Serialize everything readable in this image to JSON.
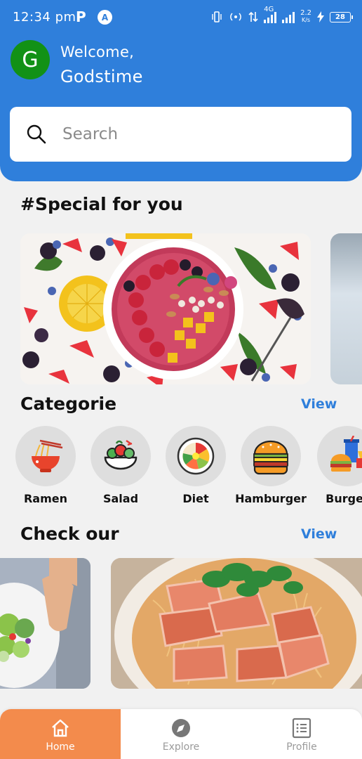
{
  "status_bar": {
    "time": "12:34 pm",
    "p_icon": "P",
    "a_icon": "A",
    "network": "4G",
    "speed": "2.2",
    "speed_unit": "K/s",
    "battery": "28"
  },
  "header": {
    "avatar_letter": "G",
    "welcome": "Welcome,",
    "username": "Godstime",
    "accent_color": "#2f7fdb"
  },
  "search": {
    "placeholder": "Search"
  },
  "special": {
    "title": "#Special for you"
  },
  "categories": {
    "title": "Categorie",
    "view_label": "View",
    "items": [
      {
        "label": "Ramen",
        "icon": "ramen-bowl-icon"
      },
      {
        "label": "Salad",
        "icon": "salad-bowl-icon"
      },
      {
        "label": "Diet",
        "icon": "diet-bowl-icon"
      },
      {
        "label": "Hamburger",
        "icon": "hamburger-icon"
      },
      {
        "label": "Burger",
        "icon": "burger-combo-icon"
      }
    ]
  },
  "check": {
    "title": "Check our",
    "view_label": "View"
  },
  "bottom_nav": {
    "active_color": "#f38b4c",
    "items": [
      {
        "label": "Home",
        "icon": "home-icon"
      },
      {
        "label": "Explore",
        "icon": "compass-icon"
      },
      {
        "label": "Profile",
        "icon": "list-icon"
      }
    ]
  }
}
